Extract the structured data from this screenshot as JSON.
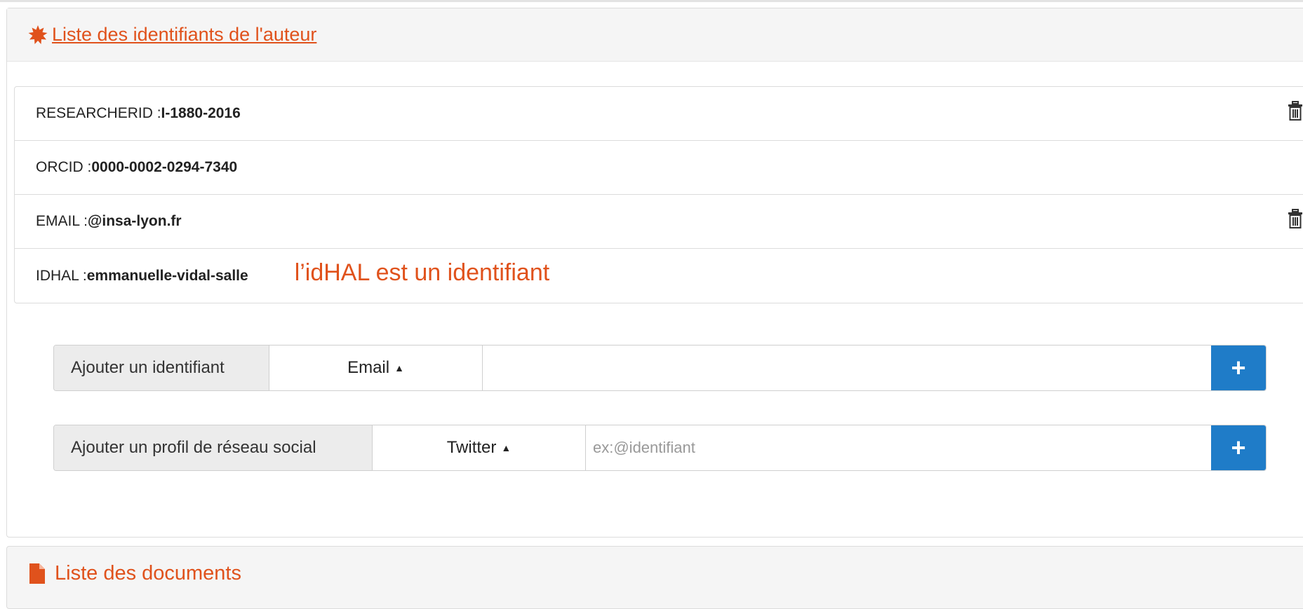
{
  "author_identifiers": {
    "title": "Liste des identifiants de l'auteur",
    "items": [
      {
        "label": "RESEARCHERID : ",
        "value": "I-1880-2016",
        "deletable": true
      },
      {
        "label": "ORCID : ",
        "value": "0000-0002-0294-7340",
        "deletable": false
      },
      {
        "label": "EMAIL : ",
        "value": "@insa-lyon.fr",
        "deletable": true
      },
      {
        "label": "IDHAL : ",
        "value": "emmanuelle-vidal-salle",
        "deletable": false
      }
    ],
    "annotation": "l’idHAL est un identifiant"
  },
  "add_identifier": {
    "label": "Ajouter un identifiant",
    "selected": "Email",
    "value": "",
    "placeholder": "",
    "button": "+"
  },
  "add_social": {
    "label": "Ajouter un profil de réseau social",
    "selected": "Twitter",
    "value": "",
    "placeholder": "ex:@identifiant",
    "button": "+"
  },
  "documents": {
    "title": "Liste des documents"
  },
  "colors": {
    "accent": "#e0521c",
    "primary_button": "#1f7cc8"
  },
  "icons": [
    "burst-icon",
    "trash-icon",
    "caret-up-icon",
    "plus-icon",
    "document-icon"
  ]
}
